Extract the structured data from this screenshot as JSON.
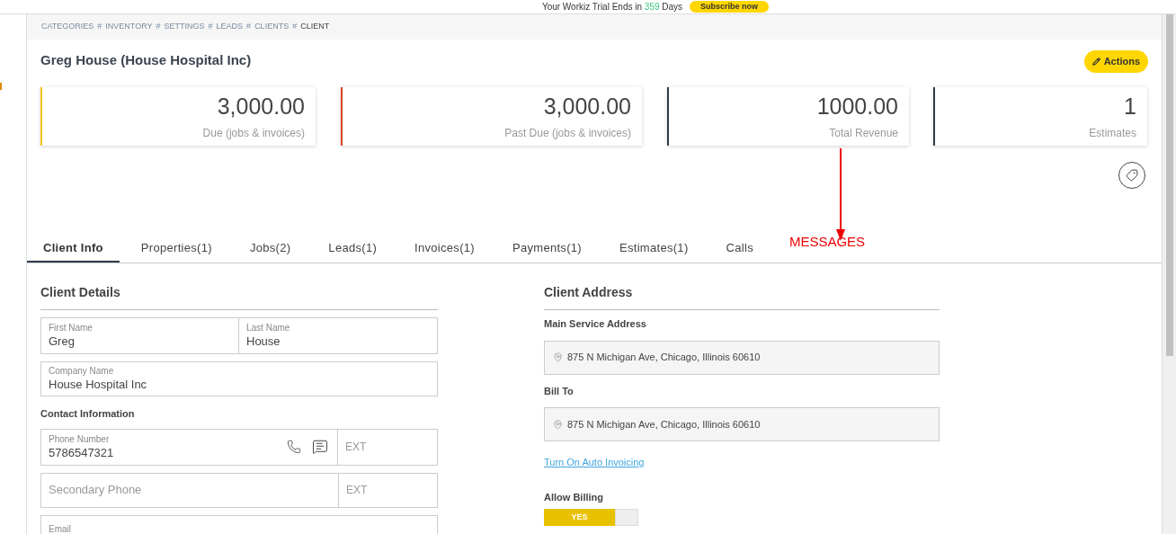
{
  "banner": {
    "text_before": "Your Workiz Trial Ends in",
    "days": "359",
    "text_after": "Days",
    "button": "Subscribe now"
  },
  "breadcrumb": [
    {
      "label": "CATEGORIES",
      "current": false
    },
    {
      "label": "INVENTORY",
      "current": false
    },
    {
      "label": "SETTINGS",
      "current": false
    },
    {
      "label": "LEADS",
      "current": false
    },
    {
      "label": "CLIENTS",
      "current": false
    },
    {
      "label": "CLIENT",
      "current": true
    }
  ],
  "breadcrumb_separator": "#",
  "title": "Greg House (House Hospital Inc)",
  "actions_button": "Actions",
  "summary_cards": [
    {
      "value": "3,000.00",
      "label": "Due (jobs & invoices)",
      "color": "#f5c518"
    },
    {
      "value": "3,000.00",
      "label": "Past Due (jobs & invoices)",
      "color": "#d9412b"
    },
    {
      "value": "1000.00",
      "label": "Total Revenue",
      "color": "#2d3a48"
    },
    {
      "value": "1",
      "label": "Estimates",
      "color": "#2d3a48"
    }
  ],
  "annotation": {
    "text": "MESSAGES"
  },
  "tabs": [
    {
      "label": "Client Info",
      "selected": true
    },
    {
      "label": "Properties(1)",
      "selected": false
    },
    {
      "label": "Jobs(2)",
      "selected": false
    },
    {
      "label": "Leads(1)",
      "selected": false
    },
    {
      "label": "Invoices(1)",
      "selected": false
    },
    {
      "label": "Payments(1)",
      "selected": false
    },
    {
      "label": "Estimates(1)",
      "selected": false
    },
    {
      "label": "Calls",
      "selected": false
    }
  ],
  "client_details": {
    "title": "Client Details",
    "first_name": {
      "label": "First Name",
      "value": "Greg"
    },
    "last_name": {
      "label": "Last Name",
      "value": "House"
    },
    "company": {
      "label": "Company Name",
      "value": "House Hospital Inc"
    },
    "contact_title": "Contact Information",
    "phone": {
      "label": "Phone Number",
      "value": "5786547321",
      "ext_placeholder": "EXT"
    },
    "secondary_phone": {
      "placeholder": "Secondary Phone",
      "ext_placeholder": "EXT"
    },
    "email": {
      "label": "Email"
    }
  },
  "client_address": {
    "title": "Client Address",
    "main_label": "Main Service Address",
    "main_address": "875 N Michigan Ave, Chicago, Illinois 60610",
    "bill_label": "Bill To",
    "bill_address": "875 N Michigan Ave, Chicago, Illinois 60610",
    "auto_invoicing_link": "Turn On Auto Invoicing",
    "allow_billing_label": "Allow Billing",
    "allow_billing": {
      "on": true,
      "text": "YES"
    }
  }
}
